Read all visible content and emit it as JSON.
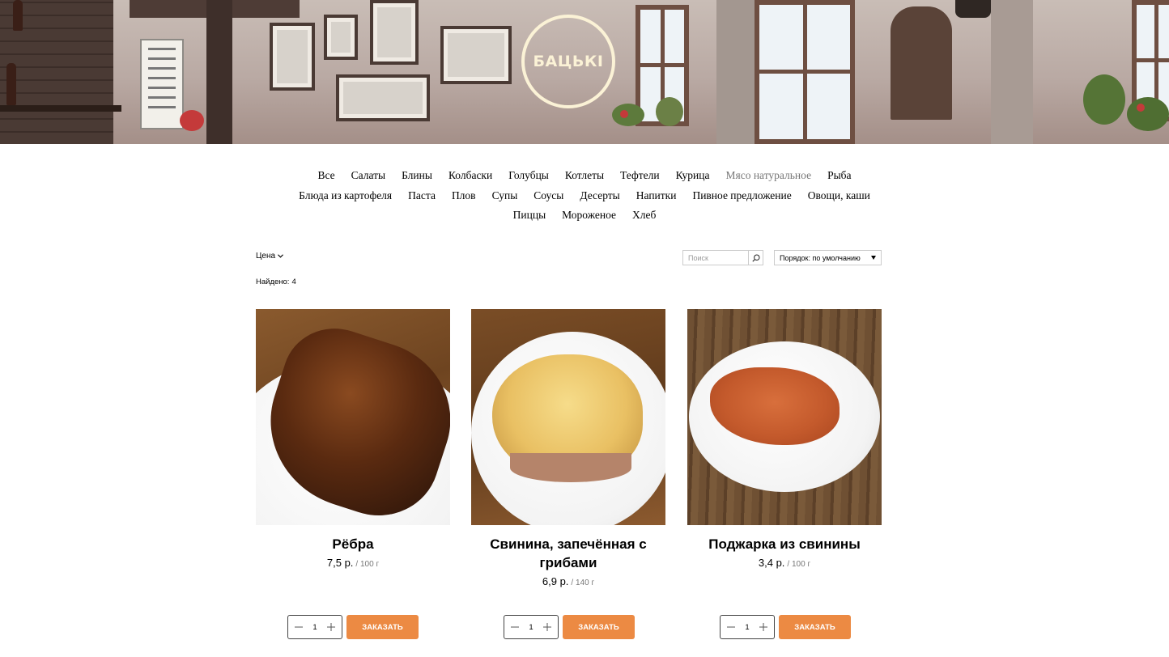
{
  "brand": {
    "logo_text": "БАЦЬКІ"
  },
  "categories": {
    "rows": [
      [
        "Все",
        "Салаты",
        "Блины",
        "Колбаски",
        "Голубцы",
        "Котлеты",
        "Тефтели",
        "Курица",
        "Мясо натуральное",
        "Рыба"
      ],
      [
        "Блюда из картофеля",
        "Паста",
        "Плов",
        "Супы",
        "Соусы",
        "Десерты",
        "Напитки",
        "Пивное предложение",
        "Овощи, каши"
      ],
      [
        "Пиццы",
        "Мороженое",
        "Хлеб"
      ]
    ],
    "active": "Мясо натуральное"
  },
  "filters": {
    "price_label": "Цена",
    "found_label": "Найдено:",
    "found_count": "4",
    "search_placeholder": "Поиск",
    "sort_label": "Порядок: по умолчанию"
  },
  "products": [
    {
      "title": "Рёбра",
      "price": "7,5 р.",
      "unit": "/ 100 г",
      "qty": "1",
      "order_label": "ЗАКАЗАТЬ"
    },
    {
      "title": "Свинина, запечённая с грибами",
      "price": "6,9 р.",
      "unit": "/ 140 г",
      "qty": "1",
      "order_label": "ЗАКАЗАТЬ"
    },
    {
      "title": "Поджарка из свинины",
      "price": "3,4 р.",
      "unit": "/ 100 г",
      "qty": "1",
      "order_label": "ЗАКАЗАТЬ"
    }
  ],
  "colors": {
    "accent": "#ec8a43",
    "logo": "#fbf2d6",
    "inactive_category": "#777777"
  },
  "icons": {
    "price_toggle": "chevron-down-icon",
    "search": "search-icon",
    "sort": "caret-down-icon",
    "minus": "minus-icon",
    "plus": "plus-icon"
  }
}
